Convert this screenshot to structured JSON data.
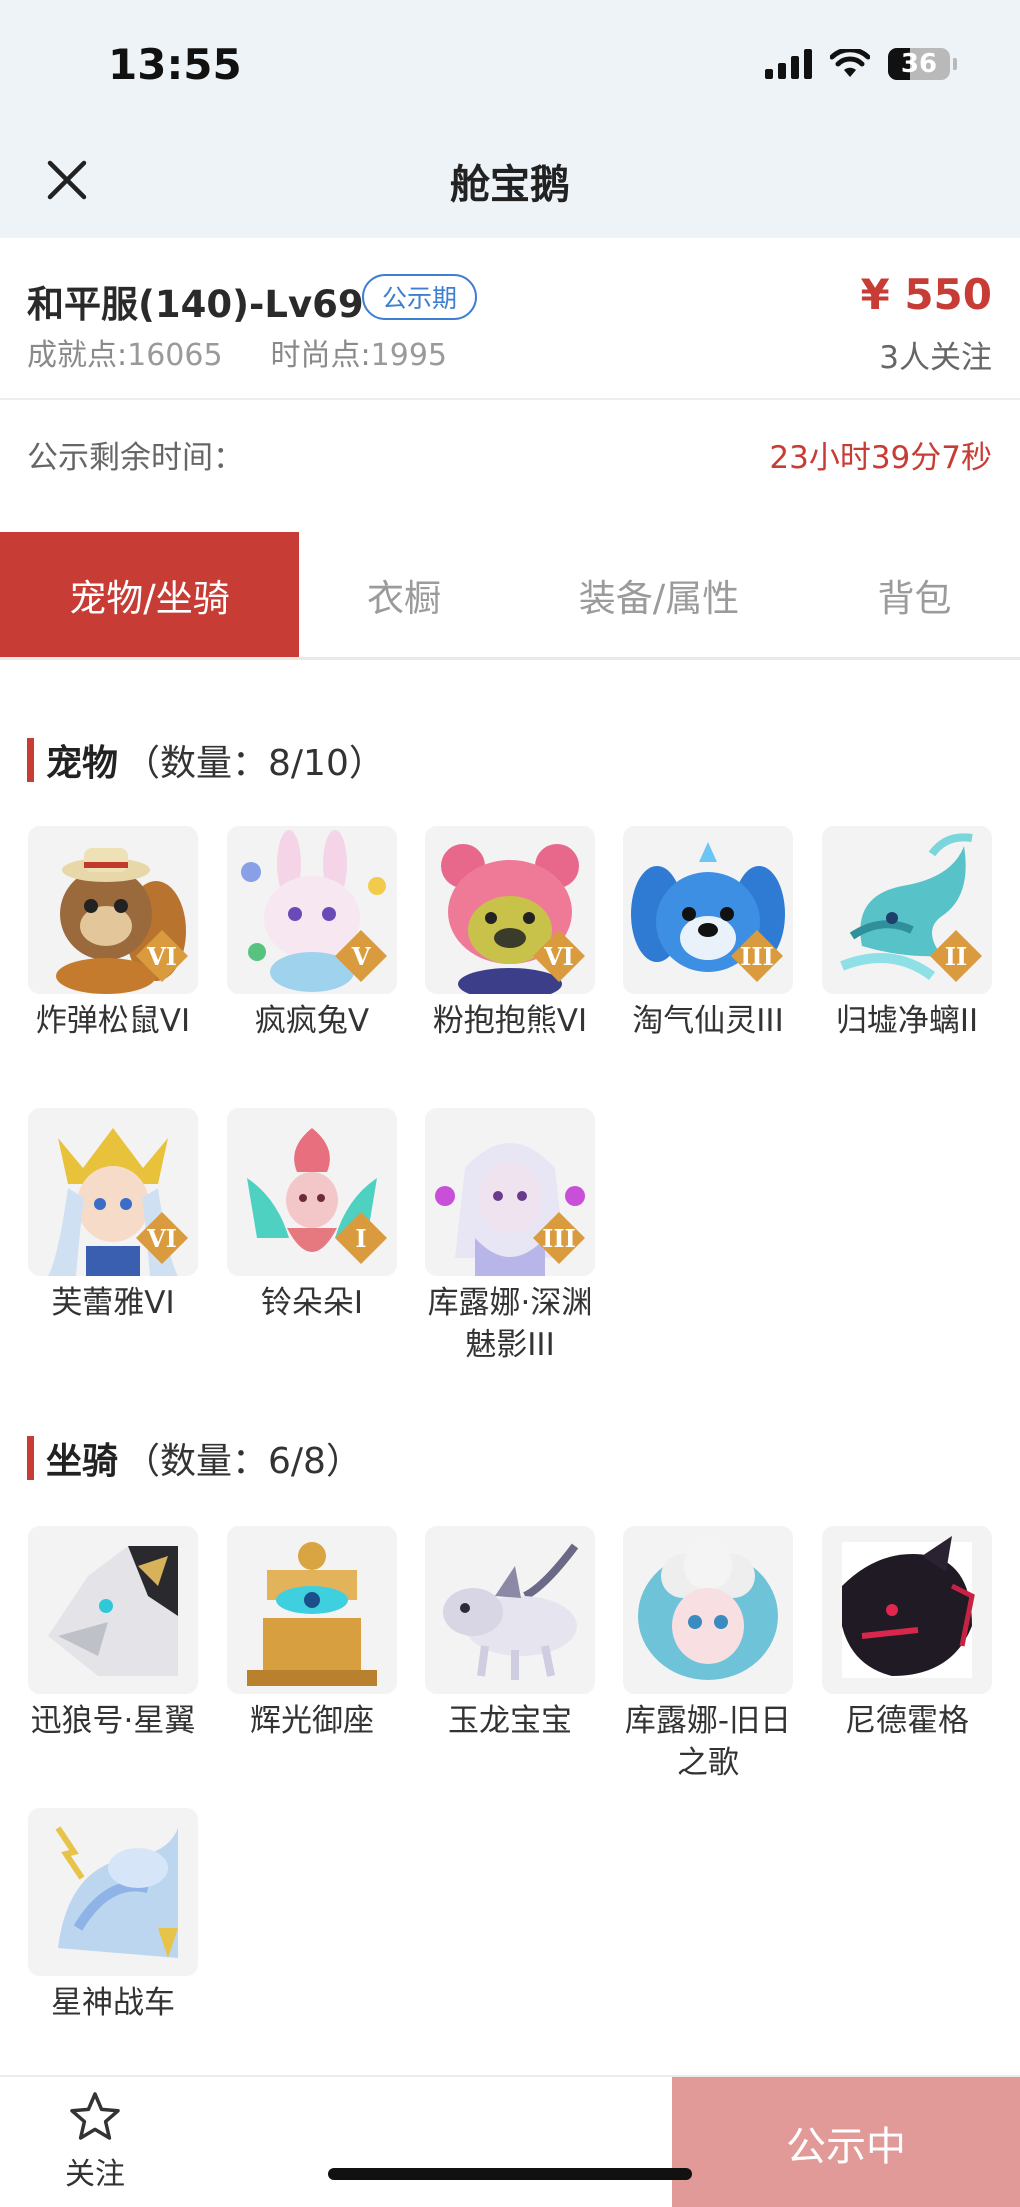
{
  "status_bar": {
    "time": "13:55",
    "battery": "36"
  },
  "nav": {
    "title": "舱宝鹅"
  },
  "info": {
    "server": "和平服(140)-Lv69",
    "badge": "公示期",
    "achievement_label": "成就点:",
    "achievement_value": "16065",
    "fashion_label": "时尚点:",
    "fashion_value": "1995",
    "price": "¥ 550",
    "followers": "3人关注"
  },
  "remaining": {
    "label": "公示剩余时间：",
    "value": "23小时39分7秒"
  },
  "tabs": [
    {
      "label": "宠物/坐骑",
      "active": true
    },
    {
      "label": "衣橱",
      "active": false
    },
    {
      "label": "装备/属性",
      "active": false
    },
    {
      "label": "背包",
      "active": false
    }
  ],
  "pets": {
    "title": "宠物",
    "count": "（数量：8/10）",
    "items": [
      {
        "name": "炸弹松鼠VI",
        "rank": "VI"
      },
      {
        "name": "疯疯兔V",
        "rank": "V"
      },
      {
        "name": "粉抱抱熊VI",
        "rank": "VI"
      },
      {
        "name": "淘气仙灵III",
        "rank": "III"
      },
      {
        "name": "归墟净螭II",
        "rank": "II"
      },
      {
        "name": "芙蕾雅VI",
        "rank": "VI"
      },
      {
        "name": "铃朵朵I",
        "rank": "I"
      },
      {
        "name": "库露娜·深渊魅影III",
        "rank": "III"
      }
    ]
  },
  "mounts": {
    "title": "坐骑",
    "count": "（数量：6/8）",
    "items": [
      {
        "name": "迅狼号·星翼"
      },
      {
        "name": "辉光御座"
      },
      {
        "name": "玉龙宝宝"
      },
      {
        "name": "库露娜-旧日之歌"
      },
      {
        "name": "尼德霍格"
      },
      {
        "name": "星神战车"
      }
    ]
  },
  "bottom_bar": {
    "follow_label": "关注",
    "action_label": "公示中"
  },
  "colors": {
    "accent": "#c73c35",
    "badge_blue": "#3f7fd1",
    "action_disabled": "#e19a98"
  },
  "icons": [
    "close-icon",
    "cellular-signal-icon",
    "wifi-icon",
    "battery-icon",
    "star-outline-icon",
    "rank-diamond-icon"
  ]
}
